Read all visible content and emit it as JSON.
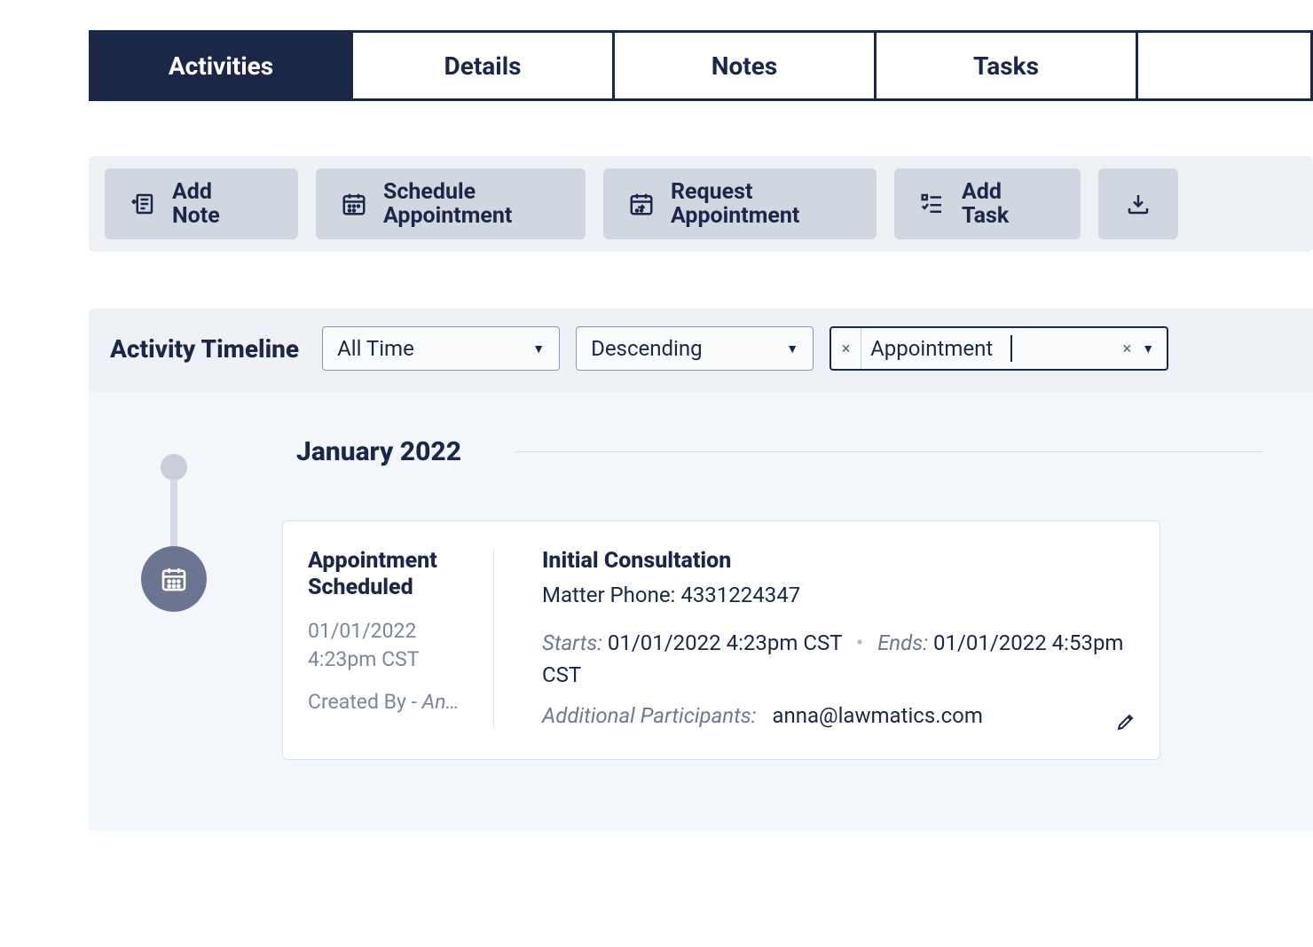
{
  "tabs": {
    "activities": "Activities",
    "details": "Details",
    "notes": "Notes",
    "tasks": "Tasks"
  },
  "quick_actions": {
    "add_note": "Add\nNote",
    "schedule_appointment": "Schedule\nAppointment",
    "request_appointment": "Request\nAppointment",
    "add_task": "Add\nTask"
  },
  "timeline": {
    "title": "Activity Timeline",
    "filters": {
      "time_range": "All Time",
      "sort": "Descending",
      "type_filter": "Appointment"
    },
    "month_label": "January 2022",
    "event": {
      "title_line1": "Appointment",
      "title_line2": "Scheduled",
      "date": "01/01/2022",
      "time": "4:23pm CST",
      "created_by_prefix": "Created By - ",
      "created_by_name": "An…",
      "right_title": "Initial Consultation",
      "matter_phone_label": "Matter Phone: ",
      "matter_phone_value": "4331224347",
      "starts_label": "Starts:",
      "starts_value": "01/01/2022 4:23pm CST",
      "ends_label": "Ends:",
      "ends_value": "01/01/2022 4:53pm CST",
      "participants_label": "Additional Participants:",
      "participants_value": "anna@lawmatics.com"
    }
  }
}
